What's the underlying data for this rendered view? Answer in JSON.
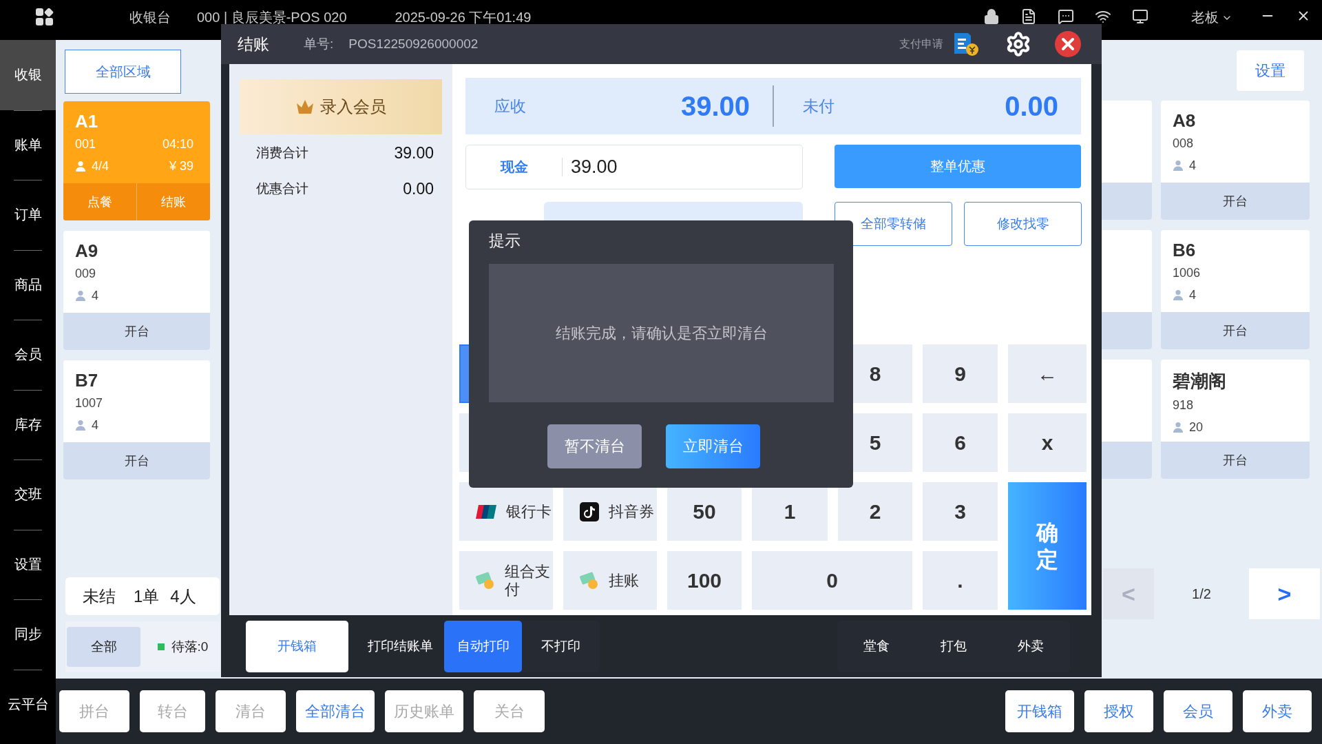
{
  "top_bar": {
    "app_title": "收银台",
    "store": "000 | 良辰美景-POS 020",
    "datetime": "2025-09-26 下午01:49",
    "user": "老板"
  },
  "nav": [
    {
      "label": "收银",
      "selected": true
    },
    {
      "label": "账单",
      "selected": false
    },
    {
      "label": "订单",
      "selected": false
    },
    {
      "label": "商品",
      "selected": false
    },
    {
      "label": "会员",
      "selected": false
    },
    {
      "label": "库存",
      "selected": false
    },
    {
      "label": "交班",
      "selected": false
    },
    {
      "label": "设置",
      "selected": false
    },
    {
      "label": "同步",
      "selected": false
    },
    {
      "label": "云平台",
      "selected": false
    }
  ],
  "area_filter": "全部区域",
  "tables_left": [
    {
      "kind": "occupied",
      "name": "A1",
      "code": "001",
      "time": "04:10",
      "guests": "4/4",
      "amount": "¥ 39",
      "actions": [
        "点餐",
        "结账"
      ]
    },
    {
      "kind": "free",
      "name": "A9",
      "code": "009",
      "guests": "4",
      "actions": [
        "开台"
      ]
    },
    {
      "kind": "free",
      "name": "B7",
      "code": "1007",
      "guests": "4",
      "actions": [
        "开台"
      ]
    }
  ],
  "summary": {
    "label": "未结",
    "orders": "1单",
    "people": "4人"
  },
  "filters": [
    {
      "label": "全部",
      "selected": true
    },
    {
      "label": "待落:0",
      "selected": false,
      "color": "#2dbd5a"
    }
  ],
  "settings_button": "设置",
  "tables_right": [
    {
      "kind": "free",
      "name": "A8",
      "code": "008",
      "guests": "4",
      "actions": [
        "开台"
      ]
    },
    {
      "kind": "free",
      "name": "B6",
      "code": "1006",
      "guests": "4",
      "actions": [
        "开台"
      ]
    },
    {
      "kind": "free",
      "name": "碧潮阁",
      "code": "918",
      "guests": "20",
      "actions": [
        "开台"
      ]
    }
  ],
  "pager": {
    "prev": "<",
    "page": "1/2",
    "next": ">",
    "prev_disabled": true
  },
  "bottom_left": [
    {
      "label": "拼台",
      "disabled": true
    },
    {
      "label": "转台",
      "disabled": true
    },
    {
      "label": "清台",
      "disabled": true
    },
    {
      "label": "全部清台",
      "disabled": false
    },
    {
      "label": "历史账单",
      "disabled": true
    },
    {
      "label": "关台",
      "disabled": true
    }
  ],
  "bottom_right": [
    "开钱箱",
    "授权",
    "会员",
    "外卖"
  ],
  "checkout": {
    "title": "结账",
    "order_label": "单号:",
    "order_no": "POS12250926000002",
    "pay_request": "支付申请",
    "member_button": "录入会员",
    "totals": [
      {
        "label": "消费合计",
        "value": "39.00"
      },
      {
        "label": "优惠合计",
        "value": "0.00"
      }
    ],
    "receivable": {
      "label": "应收",
      "value": "39.00"
    },
    "unpaid": {
      "label": "未付",
      "value": "0.00"
    },
    "cash": {
      "label": "现金",
      "value": "39.00"
    },
    "discount_button": "整单优惠",
    "change_buttons": [
      "全部零转储",
      "修改找零"
    ],
    "keypad": [
      {
        "kind": "edge",
        "selected": true
      },
      {
        "kind": "covered"
      },
      {
        "kind": "covered"
      },
      {
        "kind": "covered"
      },
      {
        "kind": "digit",
        "label": "8"
      },
      {
        "kind": "digit",
        "label": "9"
      },
      {
        "kind": "digit",
        "label": "←"
      },
      {
        "kind": "edge",
        "selected": false
      },
      {
        "kind": "covered"
      },
      {
        "kind": "covered"
      },
      {
        "kind": "covered"
      },
      {
        "kind": "digit",
        "label": "5"
      },
      {
        "kind": "digit",
        "label": "6"
      },
      {
        "kind": "digit",
        "label": "x"
      },
      {
        "kind": "pay",
        "label": "银行卡"
      },
      {
        "kind": "pay",
        "label": "抖音券"
      },
      {
        "kind": "digit",
        "label": "50"
      },
      {
        "kind": "digit",
        "label": "1"
      },
      {
        "kind": "digit",
        "label": "2"
      },
      {
        "kind": "digit",
        "label": "3"
      },
      {
        "kind": "confirm",
        "label": "确定"
      },
      {
        "kind": "pay",
        "label": "组合支付"
      },
      {
        "kind": "pay",
        "label": "挂账"
      },
      {
        "kind": "digit",
        "label": "100"
      },
      {
        "kind": "zero",
        "label": "0"
      },
      {
        "kind": "digit",
        "label": "."
      }
    ],
    "drawer_button": "开钱箱",
    "print_label": "打印结账单",
    "print_modes": [
      {
        "label": "自动打印",
        "selected": true
      },
      {
        "label": "不打印",
        "selected": false
      }
    ],
    "dine_modes": [
      {
        "label": "堂食",
        "selected": false
      },
      {
        "label": "打包",
        "selected": false
      },
      {
        "label": "外卖",
        "selected": false
      }
    ]
  },
  "prompt": {
    "title": "提示",
    "message": "结账完成，请确认是否立即清台",
    "buttons": [
      {
        "label": "暂不清台",
        "kind": "secondary"
      },
      {
        "label": "立即清台",
        "kind": "primary"
      }
    ]
  }
}
